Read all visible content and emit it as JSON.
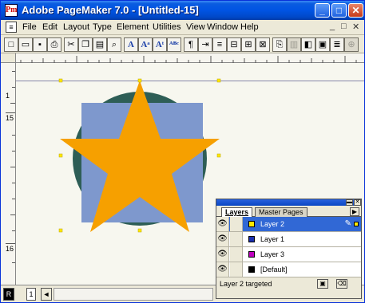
{
  "window": {
    "title": "Adobe PageMaker 7.0 - [Untitled-15]",
    "app_icon": "pagemaker-logo",
    "minimize": "_",
    "maximize": "□",
    "close": "✕"
  },
  "menu": {
    "items": [
      "File",
      "Edit",
      "Layout",
      "Type",
      "Element",
      "Utilities",
      "View",
      "Window",
      "Help"
    ],
    "doc_controls": [
      "_",
      "□",
      "✕"
    ]
  },
  "toolbar": {
    "buttons": [
      {
        "icon": "new-icon",
        "glyph": "□"
      },
      {
        "icon": "open-icon",
        "glyph": "▭"
      },
      {
        "icon": "save-icon",
        "glyph": "▪"
      },
      {
        "icon": "print-icon",
        "glyph": "⎙"
      },
      {
        "icon": "cut-icon",
        "glyph": "✂"
      },
      {
        "icon": "copy-icon",
        "glyph": "❐"
      },
      {
        "icon": "paste-icon",
        "glyph": "▤"
      },
      {
        "icon": "find-icon",
        "glyph": "⌕"
      },
      {
        "icon": "text-tool-icon",
        "glyph": "A"
      },
      {
        "icon": "character-icon",
        "glyph": "Aᵃ"
      },
      {
        "icon": "paragraph-style-icon",
        "glyph": "Aᵗ"
      },
      {
        "icon": "spelling-icon",
        "glyph": "ᴬᴮᶜ"
      },
      {
        "icon": "paragraph-icon",
        "glyph": "¶"
      },
      {
        "icon": "indents-icon",
        "glyph": "⇥"
      },
      {
        "icon": "align-icon",
        "glyph": "≡"
      },
      {
        "icon": "text-wrap-icon",
        "glyph": "⊟"
      },
      {
        "icon": "frame-icon",
        "glyph": "⊞"
      },
      {
        "icon": "place-icon",
        "glyph": "⊠"
      },
      {
        "icon": "link-icon",
        "glyph": "⎘"
      },
      {
        "icon": "colors-icon",
        "glyph": "▥"
      },
      {
        "icon": "export-pdf-icon",
        "glyph": "◧"
      },
      {
        "icon": "book-icon",
        "glyph": "▣"
      },
      {
        "icon": "zoom-icon",
        "glyph": "⊕"
      }
    ]
  },
  "ruler": {
    "vertical_labels": [
      "1",
      "15",
      "16"
    ]
  },
  "colors": {
    "star": "#f6a000",
    "square": "#7e98cd",
    "circle": "#2e5e56",
    "canvas": "#f7f7ef",
    "selected_row": "#3168d5"
  },
  "bottom": {
    "master_left": "R",
    "page_number": "1",
    "scroll_arrow": "◄"
  },
  "layers_palette": {
    "tabs": [
      "Layers",
      "Master Pages"
    ],
    "layers": [
      {
        "name": "Layer 2",
        "color": "#ffe800",
        "selected": true
      },
      {
        "name": "Layer 1",
        "color": "#1a2fb0",
        "selected": false
      },
      {
        "name": "Layer 3",
        "color": "#c000c0",
        "selected": false
      },
      {
        "name": "[Default]",
        "color": "#000000",
        "selected": false
      }
    ],
    "status": "Layer 2 targeted",
    "eye_glyph": "👁",
    "pen_glyph": "✎"
  }
}
